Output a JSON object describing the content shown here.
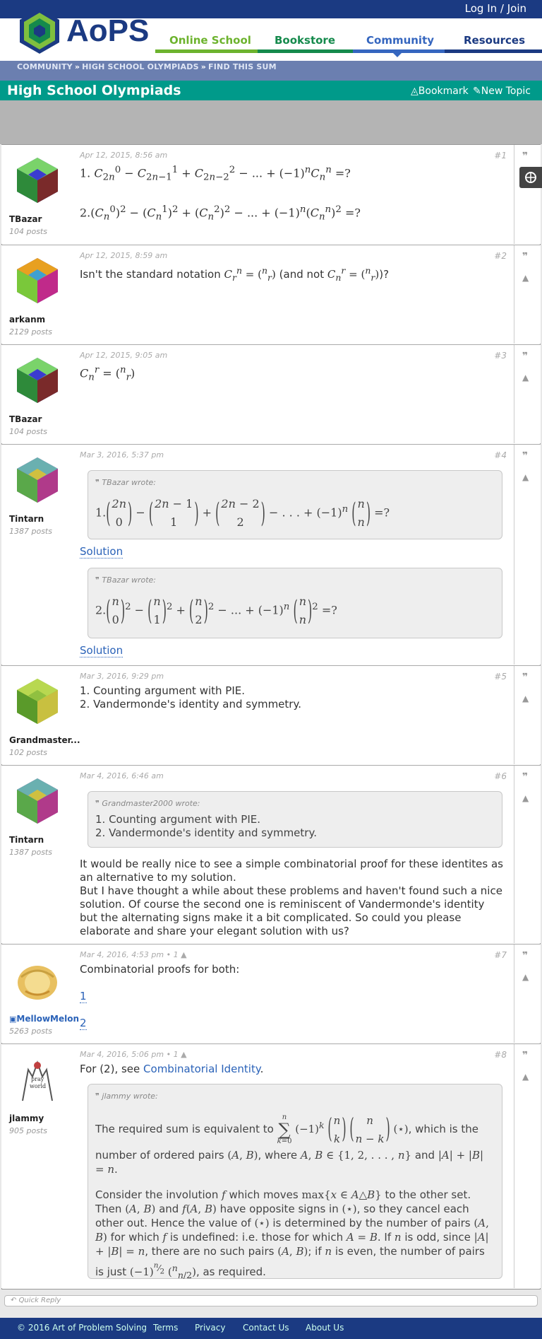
{
  "header": {
    "login": "Log In / Join",
    "logo_text": "AoPS",
    "nav": [
      {
        "label": "Online School",
        "color": "#6db32e"
      },
      {
        "label": "Bookstore",
        "color": "#158a4c"
      },
      {
        "label": "Community",
        "color": "#3566bf"
      },
      {
        "label": "Resources",
        "color": "#1b3a82"
      }
    ]
  },
  "breadcrumb": [
    "COMMUNITY",
    "HIGH SCHOOL OLYMPIADS",
    "FIND THIS SUM"
  ],
  "forum": {
    "title": "High School Olympiads",
    "bookmark": "Bookmark",
    "new_topic": "New Topic"
  },
  "posts": [
    {
      "num": "#1",
      "date": "Apr 12, 2015, 8:56 am",
      "user": "TBazar",
      "posts": "104 posts"
    },
    {
      "num": "#2",
      "date": "Apr 12, 2015, 8:59 am",
      "user": "arkanm",
      "posts": "2129 posts",
      "text_a": "Isn't the standard notation",
      "text_b": "(and not",
      "text_c": ")?"
    },
    {
      "num": "#3",
      "date": "Apr 12, 2015, 9:05 am",
      "user": "TBazar",
      "posts": "104 posts"
    },
    {
      "num": "#4",
      "date": "Mar 3, 2016, 5:37 pm",
      "user": "Tintarn",
      "posts": "1387 posts",
      "quote_author": "TBazar wrote:",
      "solution1": "Solution",
      "solution2": "Solution"
    },
    {
      "num": "#5",
      "date": "Mar 3, 2016, 9:29 pm",
      "user": "Grandmaster...",
      "posts": "102 posts",
      "line1": "1. Counting argument with PIE.",
      "line2": "2. Vandermonde's identity and symmetry."
    },
    {
      "num": "#6",
      "date": "Mar 4, 2016, 6:46 am",
      "user": "Tintarn",
      "posts": "1387 posts",
      "quote_author": "Grandmaster2000 wrote:",
      "quote_line1": "1. Counting argument with PIE.",
      "quote_line2": "2. Vandermonde's identity and symmetry.",
      "body": "It would be really nice to see a simple combinatorial proof for these identites as an alternative to my solution.",
      "body2": "But I have thought a while about these problems and haven't found such a nice solution. Of course the second one is reminiscent of Vandermonde's identity but the alternating signs make it a bit complicated. So could you please elaborate and share your elegant solution with us?"
    },
    {
      "num": "#7",
      "date": "Mar 4, 2016, 4:53 pm • 1",
      "user": "MellowMelon",
      "posts": "5263 posts",
      "text": "Combinatorial proofs for both:",
      "link1": "1",
      "link2": "2"
    },
    {
      "num": "#8",
      "date": "Mar 4, 2016, 5:06 pm • 1",
      "user": "jlammy",
      "posts": "905 posts",
      "text_a": "For (2), see",
      "link": "Combinatorial Identity",
      "text_b": ".",
      "quote_author": "jlammy wrote:",
      "q_p1a": "The required sum is equivalent to",
      "q_p1b": ", which is the number of ordered pairs",
      "q_p1c": ", where",
      "q_p1d": "and",
      "q_p2": "Consider the involution",
      "q_p2b": "which moves",
      "q_p2c": "to the other set. Then",
      "q_p2d": "and",
      "q_p2e": "have opposite signs in",
      "q_p2f": ", so they cancel each other out. Hence the value of",
      "q_p2g": "is determined by the number of pairs",
      "q_p2h": "for which",
      "q_p2i": "is undefined: i.e. those for which",
      "q_p2j": ". If",
      "q_p2k": "is odd, since",
      "q_p2l": ", there are no such pairs",
      "q_p2m": "; if",
      "q_p2n": "is even, the number of pairs is just",
      "q_p2o": ", as required."
    }
  ],
  "quick_reply": "Quick Reply",
  "footer": [
    "© 2016 Art of Problem Solving",
    "Terms",
    "Privacy",
    "Contact Us",
    "About Us"
  ]
}
